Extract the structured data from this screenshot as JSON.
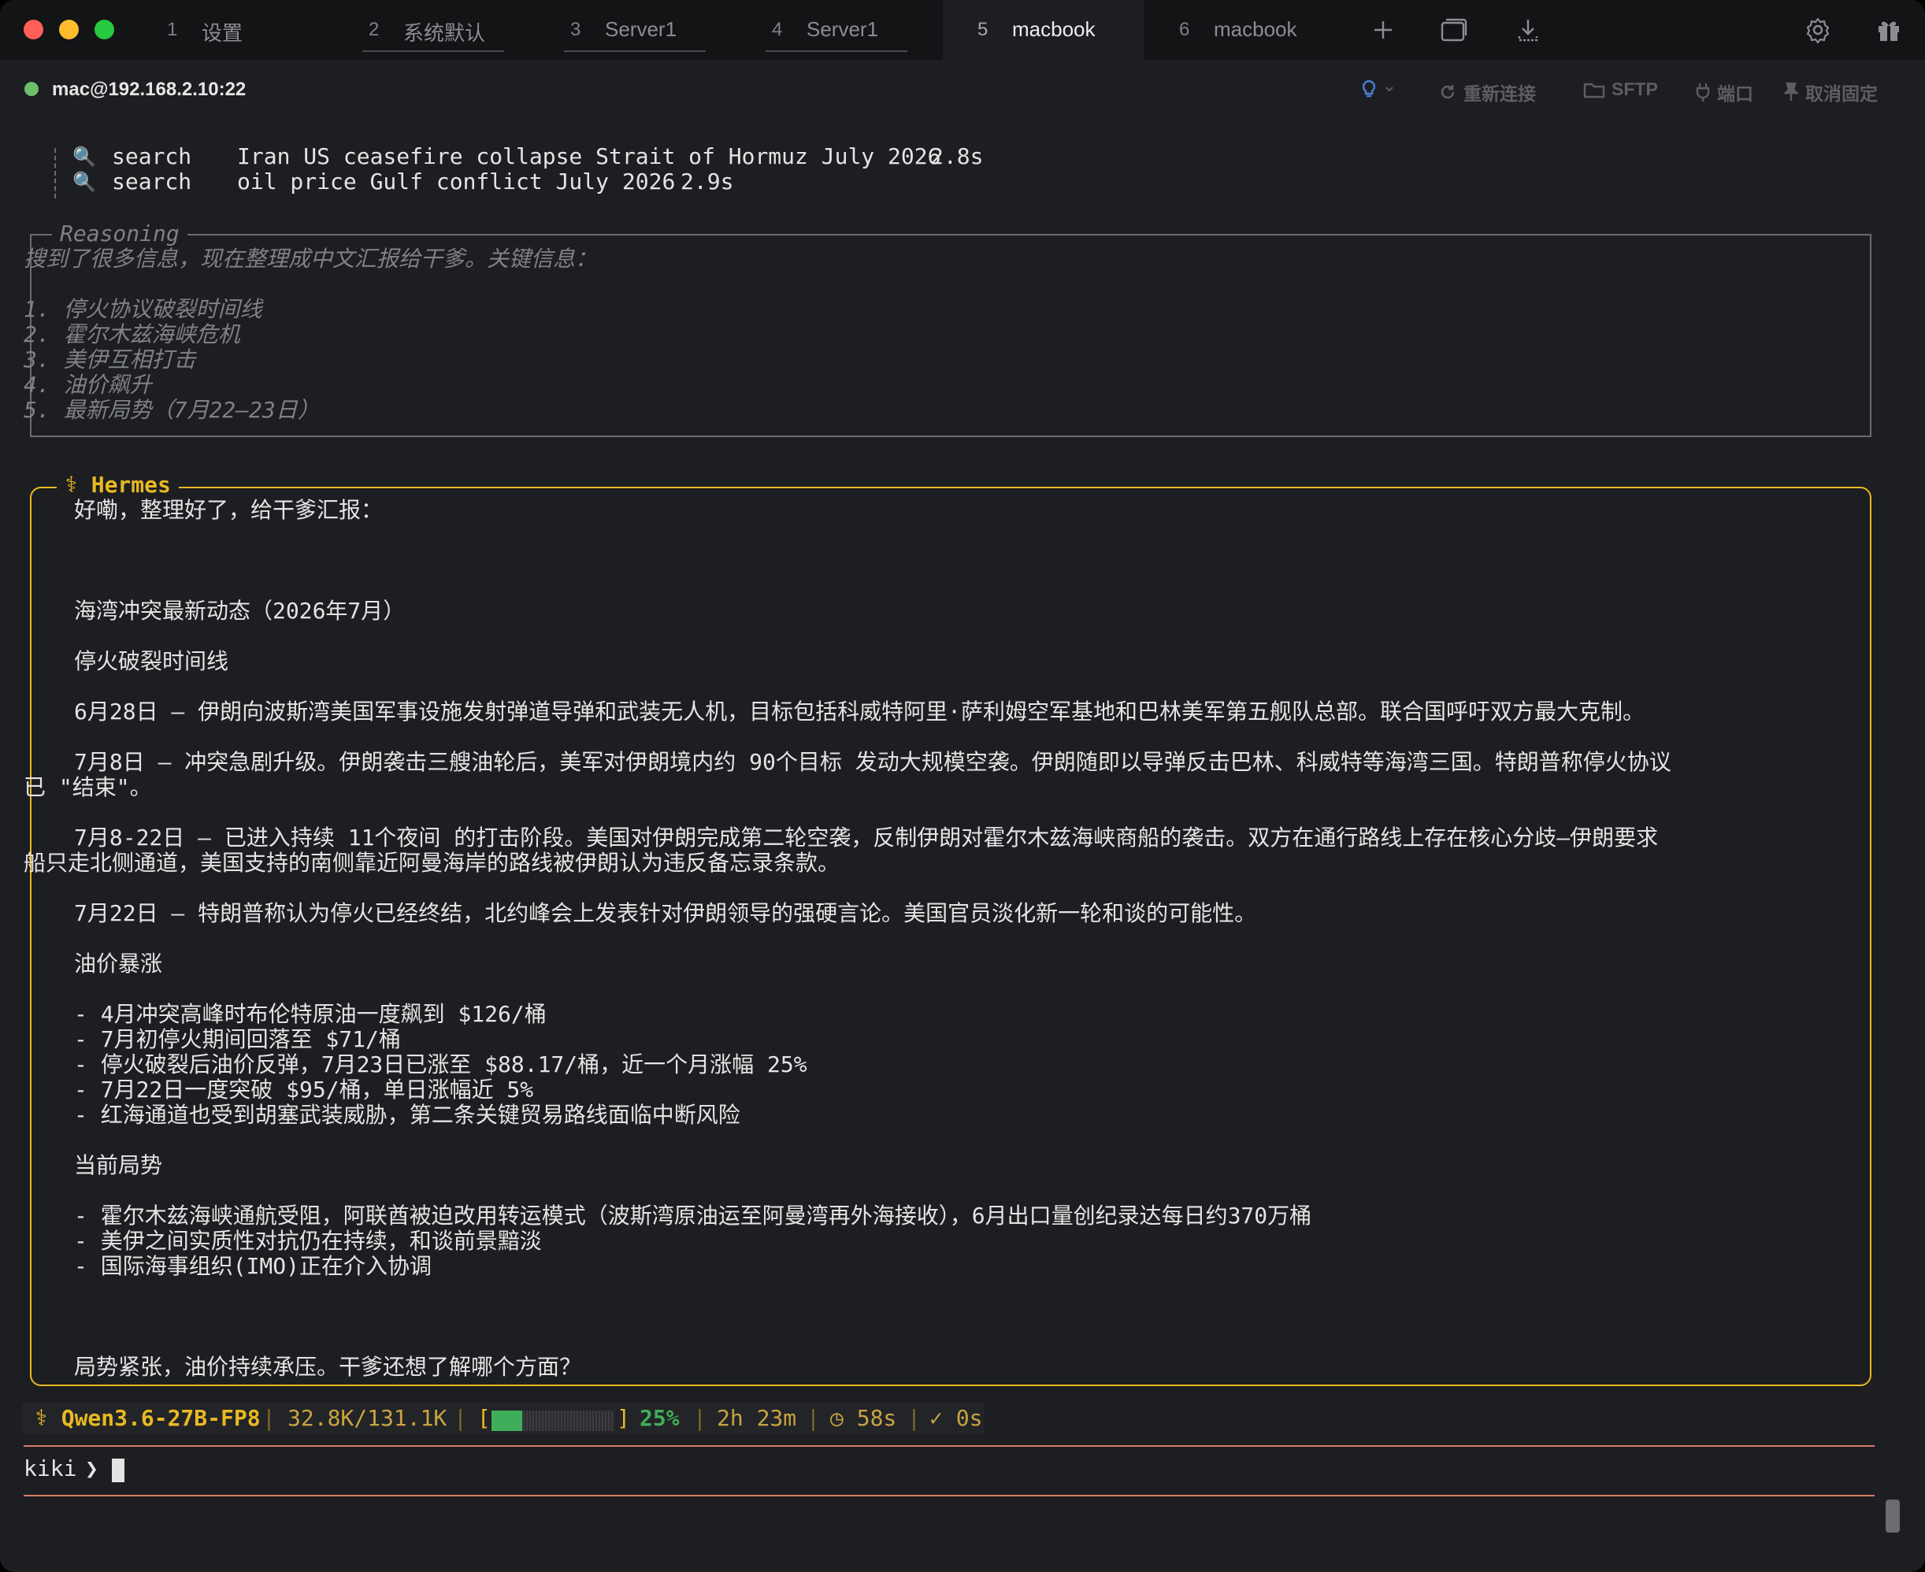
{
  "window_controls": {
    "close_color": "#ff5f57",
    "minimize_color": "#febc2e",
    "maximize_color": "#28c840"
  },
  "tabs": [
    {
      "num": "1",
      "label": "设置"
    },
    {
      "num": "2",
      "label": "系统默认"
    },
    {
      "num": "3",
      "label": "Server1"
    },
    {
      "num": "4",
      "label": "Server1"
    },
    {
      "num": "5",
      "label": "macbook",
      "active": true
    },
    {
      "num": "6",
      "label": "macbook"
    }
  ],
  "toolbar_icons": [
    "plus-icon",
    "window-icon",
    "download-icon",
    "gear-icon",
    "gift-icon"
  ],
  "connection": {
    "status_color": "#6cbf6a",
    "host": "mac@192.168.2.10:22",
    "reconnect_label": "重新连接",
    "sftp_label": "SFTP",
    "port_label": "端口",
    "unpin_label": "取消固定"
  },
  "searches": [
    {
      "cmd": "search",
      "query": "Iran US ceasefire collapse Strait of Hormuz July 2026",
      "time": "2.8s"
    },
    {
      "cmd": "search",
      "query": "oil price Gulf conflict July 2026",
      "time": "2.9s"
    }
  ],
  "reasoning": {
    "title": "Reasoning",
    "intro": "搜到了很多信息，现在整理成中文汇报给干爹。关键信息：",
    "items": [
      "1. 停火协议破裂时间线",
      "2. 霍尔木兹海峡危机",
      "3. 美伊互相打击",
      "4. 油价飙升",
      "5. 最新局势（7月22–23日）"
    ]
  },
  "hermes": {
    "title": "Hermes",
    "greeting": "好嘞，整理好了，给干爹汇报：",
    "heading": "海湾冲突最新动态（2026年7月）",
    "section_timeline": "停火破裂时间线",
    "p1": "6月28日 — 伊朗向波斯湾美国军事设施发射弹道导弹和武装无人机，目标包括科威特阿里·萨利姆空军基地和巴林美军第五舰队总部。联合国呼吁双方最大克制。",
    "p2a": "7月8日 — 冲突急剧升级。伊朗袭击三艘油轮后，美军对伊朗境内约 90个目标 发动大规模空袭。伊朗随即以导弹反击巴林、科威特等海湾三国。特朗普称停火协议",
    "p2b": "已 \"结束\"。",
    "p3a": "7月8-22日 — 已进入持续 11个夜间 的打击阶段。美国对伊朗完成第二轮空袭，反制伊朗对霍尔木兹海峡商船的袭击。双方在通行路线上存在核心分歧—伊朗要求",
    "p3b": "船只走北侧通道，美国支持的南侧靠近阿曼海岸的路线被伊朗认为违反备忘录条款。",
    "p4": "7月22日 — 特朗普称认为停火已经终结，北约峰会上发表针对伊朗领导的强硬言论。美国官员淡化新一轮和谈的可能性。",
    "section_oil": "油价暴涨",
    "oil": [
      "- 4月冲突高峰时布伦特原油一度飙到 $126/桶",
      "- 7月初停火期间回落至 $71/桶",
      "- 停火破裂后油价反弹，7月23日已涨至 $88.17/桶，近一个月涨幅 25%",
      "- 7月22日一度突破 $95/桶，单日涨幅近 5%",
      "- 红海通道也受到胡塞武装威胁，第二条关键贸易路线面临中断风险"
    ],
    "section_current": "当前局势",
    "current": [
      "- 霍尔木兹海峡通航受阻，阿联酋被迫改用转运模式（波斯湾原油运至阿曼湾再外海接收），6月出口量创纪录达每日约370万桶",
      "- 美伊之间实质性对抗仍在持续，和谈前景黯淡",
      "- 国际海事组织(IMO)正在介入协调"
    ],
    "closing": "局势紧张，油价持续承压。干爹还想了解哪个方面？"
  },
  "status": {
    "model": "Qwen3.6-27B-FP8",
    "tokens": "32.8K/131.1K",
    "context_fraction": 0.25,
    "context_pct": "25%",
    "elapsed": "2h 23m",
    "timer": "58s",
    "check": "0s",
    "accent": "#e8b923",
    "green": "#3fae5a"
  },
  "prompt": {
    "user": "kiki",
    "symbol": "❯"
  },
  "colors": {
    "reason_rule": "#6a6c70",
    "hermes_rule": "#e8b923",
    "prompt_rule": "#d97b68"
  }
}
